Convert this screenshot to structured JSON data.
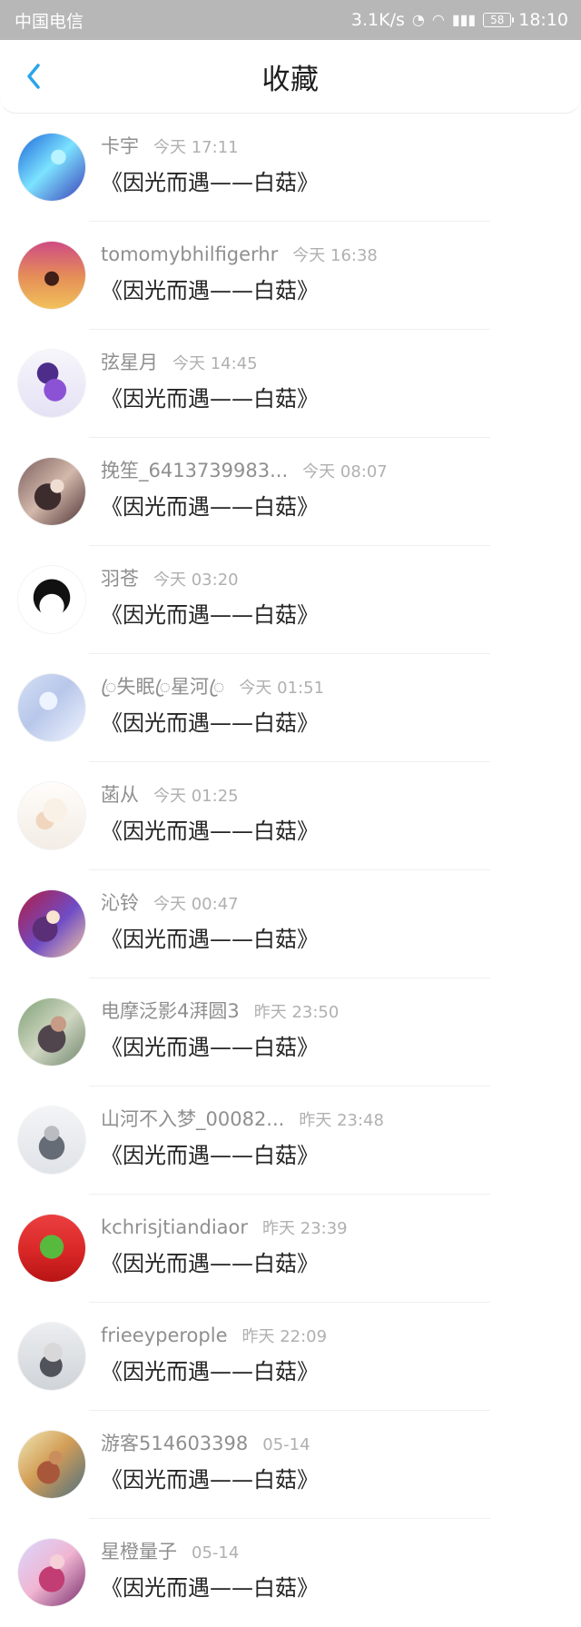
{
  "status_bar": {
    "carrier": "中国电信",
    "network_speed": "3.1K/s",
    "battery_level": "58",
    "time": "18:10"
  },
  "header": {
    "title": "收藏"
  },
  "items": [
    {
      "username": "卡宇",
      "time": "今天 17:11",
      "title": "《因光而遇——白菇》"
    },
    {
      "username": "tomomybhilfigerhr",
      "time": "今天 16:38",
      "title": "《因光而遇——白菇》"
    },
    {
      "username": "弦星月",
      "time": "今天 14:45",
      "title": "《因光而遇——白菇》"
    },
    {
      "username": "挽笙_6413739983...",
      "time": "今天 08:07",
      "title": "《因光而遇——白菇》"
    },
    {
      "username": "羽苍",
      "time": "今天 03:20",
      "title": "《因光而遇——白菇》"
    },
    {
      "username": "ꦿ失眠ꦿ星河ꦿ",
      "time": "今天 01:51",
      "title": "《因光而遇——白菇》"
    },
    {
      "username": "菡从",
      "time": "今天 01:25",
      "title": "《因光而遇——白菇》"
    },
    {
      "username": "沁铃",
      "time": "今天 00:47",
      "title": "《因光而遇——白菇》"
    },
    {
      "username": "电摩泛影4湃圆3",
      "time": "昨天 23:50",
      "title": "《因光而遇——白菇》"
    },
    {
      "username": "山河不入梦_00082...",
      "time": "昨天 23:48",
      "title": "《因光而遇——白菇》"
    },
    {
      "username": "kchrisjtiandiaor",
      "time": "昨天 23:39",
      "title": "《因光而遇——白菇》"
    },
    {
      "username": "frieeyperople",
      "time": "昨天 22:09",
      "title": "《因光而遇——白菇》"
    },
    {
      "username": "游客514603398",
      "time": "05-14",
      "title": "《因光而遇——白菇》"
    },
    {
      "username": "星橙量子",
      "time": "05-14",
      "title": "《因光而遇——白菇》"
    }
  ]
}
